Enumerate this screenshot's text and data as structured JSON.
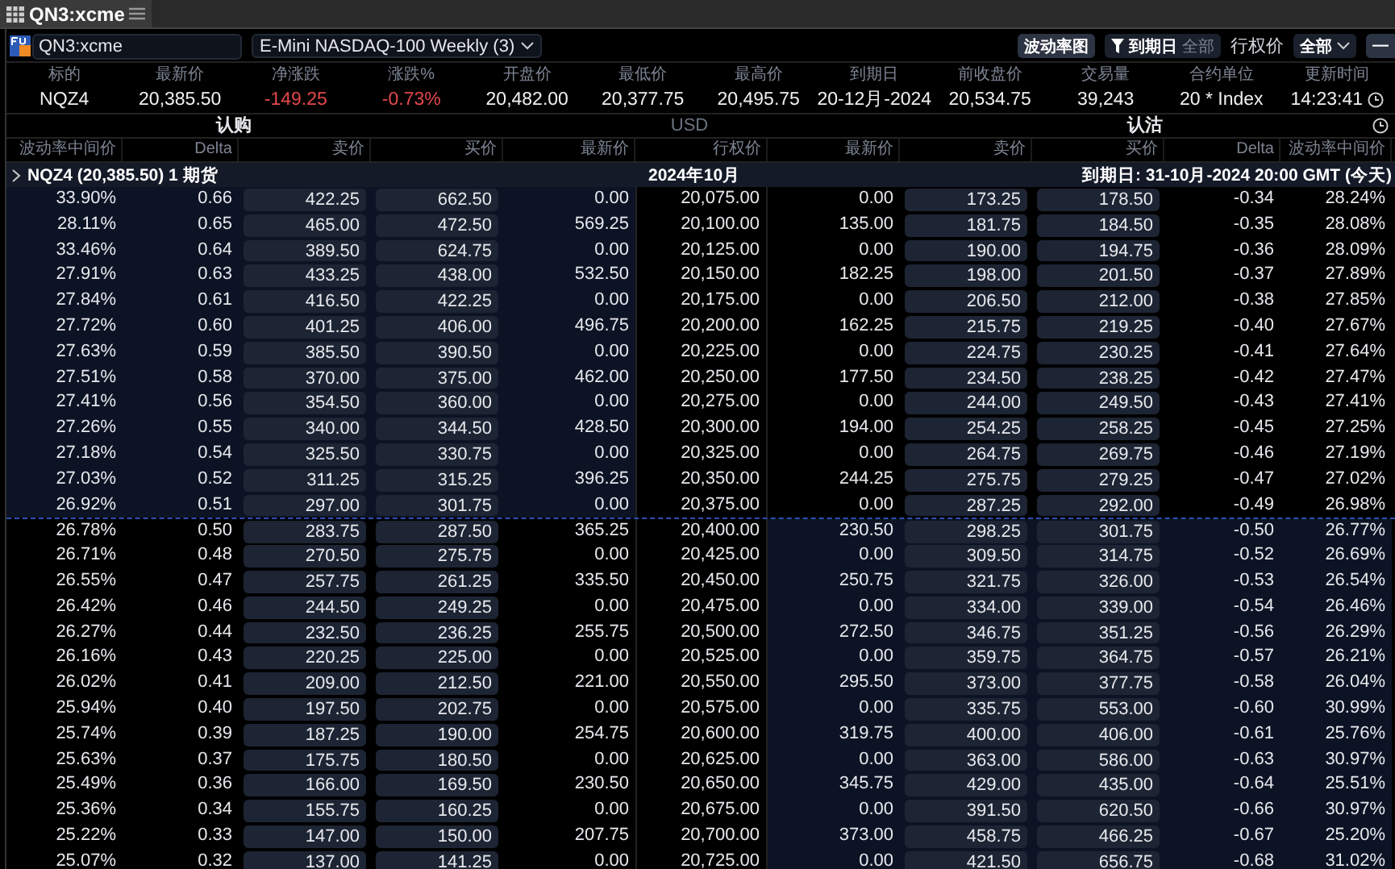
{
  "window": {
    "tab_title": "QN3:xcme"
  },
  "toolbar": {
    "symbol_field": "QN3:xcme",
    "product_dropdown": "E-Mini NASDAQ-100 Weekly (3)",
    "vol_chart_button": "波动率图",
    "filter_button": {
      "label": "到期日",
      "value": "全部"
    },
    "strike_label": "行权价",
    "strike_dropdown": "全部",
    "overflow_button": "—"
  },
  "summary": [
    {
      "label": "标的",
      "value": "NQZ4",
      "negative": false
    },
    {
      "label": "最新价",
      "value": "20,385.50",
      "negative": false
    },
    {
      "label": "净涨跌",
      "value": "-149.25",
      "negative": true
    },
    {
      "label": "涨跌%",
      "value": "-0.73%",
      "negative": true
    },
    {
      "label": "开盘价",
      "value": "20,482.00",
      "negative": false
    },
    {
      "label": "最低价",
      "value": "20,377.75",
      "negative": false
    },
    {
      "label": "最高价",
      "value": "20,495.75",
      "negative": false
    },
    {
      "label": "到期日",
      "value": "20-12月-2024",
      "negative": false
    },
    {
      "label": "前收盘价",
      "value": "20,534.75",
      "negative": false
    },
    {
      "label": "交易量",
      "value": "39,243",
      "negative": false
    },
    {
      "label": "合约单位",
      "value": "20 * Index",
      "negative": false
    },
    {
      "label": "更新时间",
      "value": "14:23:41",
      "negative": false
    }
  ],
  "sides": {
    "calls": "认购",
    "currency": "USD",
    "puts": "认沽"
  },
  "columns": [
    "波动率中间价",
    "Delta",
    "卖价",
    "买价",
    "最新价",
    "行权价",
    "最新价",
    "卖价",
    "买价",
    "Delta",
    "波动率中间价"
  ],
  "group": {
    "title": "NQZ4 (20,385.50) 1 期货",
    "expanded": false,
    "month": "2024年10月",
    "expiry": "到期日: 31-10月-2024 20:00 GMT (今天)"
  },
  "rows": [
    {
      "call": [
        "33.90%",
        "0.66",
        "422.25",
        "662.50",
        "0.00"
      ],
      "strike": "20,075.00",
      "put": [
        "0.00",
        "173.25",
        "178.50",
        "-0.34",
        "28.24%"
      ],
      "call_itm": true
    },
    {
      "call": [
        "28.11%",
        "0.65",
        "465.00",
        "472.50",
        "569.25"
      ],
      "strike": "20,100.00",
      "put": [
        "135.00",
        "181.75",
        "184.50",
        "-0.35",
        "28.08%"
      ],
      "call_itm": true
    },
    {
      "call": [
        "33.46%",
        "0.64",
        "389.50",
        "624.75",
        "0.00"
      ],
      "strike": "20,125.00",
      "put": [
        "0.00",
        "190.00",
        "194.75",
        "-0.36",
        "28.09%"
      ],
      "call_itm": true
    },
    {
      "call": [
        "27.91%",
        "0.63",
        "433.25",
        "438.00",
        "532.50"
      ],
      "strike": "20,150.00",
      "put": [
        "182.25",
        "198.00",
        "201.50",
        "-0.37",
        "27.89%"
      ],
      "call_itm": true
    },
    {
      "call": [
        "27.84%",
        "0.61",
        "416.50",
        "422.25",
        "0.00"
      ],
      "strike": "20,175.00",
      "put": [
        "0.00",
        "206.50",
        "212.00",
        "-0.38",
        "27.85%"
      ],
      "call_itm": true
    },
    {
      "call": [
        "27.72%",
        "0.60",
        "401.25",
        "406.00",
        "496.75"
      ],
      "strike": "20,200.00",
      "put": [
        "162.25",
        "215.75",
        "219.25",
        "-0.40",
        "27.67%"
      ],
      "call_itm": true
    },
    {
      "call": [
        "27.63%",
        "0.59",
        "385.50",
        "390.50",
        "0.00"
      ],
      "strike": "20,225.00",
      "put": [
        "0.00",
        "224.75",
        "230.25",
        "-0.41",
        "27.64%"
      ],
      "call_itm": true
    },
    {
      "call": [
        "27.51%",
        "0.58",
        "370.00",
        "375.00",
        "462.00"
      ],
      "strike": "20,250.00",
      "put": [
        "177.50",
        "234.50",
        "238.25",
        "-0.42",
        "27.47%"
      ],
      "call_itm": true
    },
    {
      "call": [
        "27.41%",
        "0.56",
        "354.50",
        "360.00",
        "0.00"
      ],
      "strike": "20,275.00",
      "put": [
        "0.00",
        "244.00",
        "249.50",
        "-0.43",
        "27.41%"
      ],
      "call_itm": true
    },
    {
      "call": [
        "27.26%",
        "0.55",
        "340.00",
        "344.50",
        "428.50"
      ],
      "strike": "20,300.00",
      "put": [
        "194.00",
        "254.25",
        "258.25",
        "-0.45",
        "27.25%"
      ],
      "call_itm": true
    },
    {
      "call": [
        "27.18%",
        "0.54",
        "325.50",
        "330.75",
        "0.00"
      ],
      "strike": "20,325.00",
      "put": [
        "0.00",
        "264.75",
        "269.75",
        "-0.46",
        "27.19%"
      ],
      "call_itm": true
    },
    {
      "call": [
        "27.03%",
        "0.52",
        "311.25",
        "315.25",
        "396.25"
      ],
      "strike": "20,350.00",
      "put": [
        "244.25",
        "275.75",
        "279.25",
        "-0.47",
        "27.02%"
      ],
      "call_itm": true
    },
    {
      "call": [
        "26.92%",
        "0.51",
        "297.00",
        "301.75",
        "0.00"
      ],
      "strike": "20,375.00",
      "put": [
        "0.00",
        "287.25",
        "292.00",
        "-0.49",
        "26.98%"
      ],
      "call_itm": true
    },
    {
      "call": [
        "26.78%",
        "0.50",
        "283.75",
        "287.50",
        "365.25"
      ],
      "strike": "20,400.00",
      "put": [
        "230.50",
        "298.25",
        "301.75",
        "-0.50",
        "26.77%"
      ],
      "call_itm": false
    },
    {
      "call": [
        "26.71%",
        "0.48",
        "270.50",
        "275.75",
        "0.00"
      ],
      "strike": "20,425.00",
      "put": [
        "0.00",
        "309.50",
        "314.75",
        "-0.52",
        "26.69%"
      ],
      "call_itm": false
    },
    {
      "call": [
        "26.55%",
        "0.47",
        "257.75",
        "261.25",
        "335.50"
      ],
      "strike": "20,450.00",
      "put": [
        "250.75",
        "321.75",
        "326.00",
        "-0.53",
        "26.54%"
      ],
      "call_itm": false
    },
    {
      "call": [
        "26.42%",
        "0.46",
        "244.50",
        "249.25",
        "0.00"
      ],
      "strike": "20,475.00",
      "put": [
        "0.00",
        "334.00",
        "339.00",
        "-0.54",
        "26.46%"
      ],
      "call_itm": false
    },
    {
      "call": [
        "26.27%",
        "0.44",
        "232.50",
        "236.25",
        "255.75"
      ],
      "strike": "20,500.00",
      "put": [
        "272.50",
        "346.75",
        "351.25",
        "-0.56",
        "26.29%"
      ],
      "call_itm": false
    },
    {
      "call": [
        "26.16%",
        "0.43",
        "220.25",
        "225.00",
        "0.00"
      ],
      "strike": "20,525.00",
      "put": [
        "0.00",
        "359.75",
        "364.75",
        "-0.57",
        "26.21%"
      ],
      "call_itm": false
    },
    {
      "call": [
        "26.02%",
        "0.41",
        "209.00",
        "212.50",
        "221.00"
      ],
      "strike": "20,550.00",
      "put": [
        "295.50",
        "373.00",
        "377.75",
        "-0.58",
        "26.04%"
      ],
      "call_itm": false
    },
    {
      "call": [
        "25.94%",
        "0.40",
        "197.50",
        "202.75",
        "0.00"
      ],
      "strike": "20,575.00",
      "put": [
        "0.00",
        "335.75",
        "553.00",
        "-0.60",
        "30.99%"
      ],
      "call_itm": false
    },
    {
      "call": [
        "25.74%",
        "0.39",
        "187.25",
        "190.00",
        "254.75"
      ],
      "strike": "20,600.00",
      "put": [
        "319.75",
        "400.00",
        "406.00",
        "-0.61",
        "25.76%"
      ],
      "call_itm": false
    },
    {
      "call": [
        "25.63%",
        "0.37",
        "175.75",
        "180.50",
        "0.00"
      ],
      "strike": "20,625.00",
      "put": [
        "0.00",
        "363.00",
        "586.00",
        "-0.63",
        "30.97%"
      ],
      "call_itm": false
    },
    {
      "call": [
        "25.49%",
        "0.36",
        "166.00",
        "169.50",
        "230.50"
      ],
      "strike": "20,650.00",
      "put": [
        "345.75",
        "429.00",
        "435.00",
        "-0.64",
        "25.51%"
      ],
      "call_itm": false
    },
    {
      "call": [
        "25.36%",
        "0.34",
        "155.75",
        "160.25",
        "0.00"
      ],
      "strike": "20,675.00",
      "put": [
        "0.00",
        "391.50",
        "620.50",
        "-0.66",
        "30.97%"
      ],
      "call_itm": false
    },
    {
      "call": [
        "25.22%",
        "0.33",
        "147.00",
        "150.00",
        "207.75"
      ],
      "strike": "20,700.00",
      "put": [
        "373.00",
        "458.75",
        "466.25",
        "-0.67",
        "25.20%"
      ],
      "call_itm": false
    },
    {
      "call": [
        "25.07%",
        "0.32",
        "137.00",
        "141.25",
        "0.00"
      ],
      "strike": "20,725.00",
      "put": [
        "0.00",
        "421.50",
        "656.75",
        "-0.68",
        "31.02%"
      ],
      "call_itm": false
    }
  ]
}
